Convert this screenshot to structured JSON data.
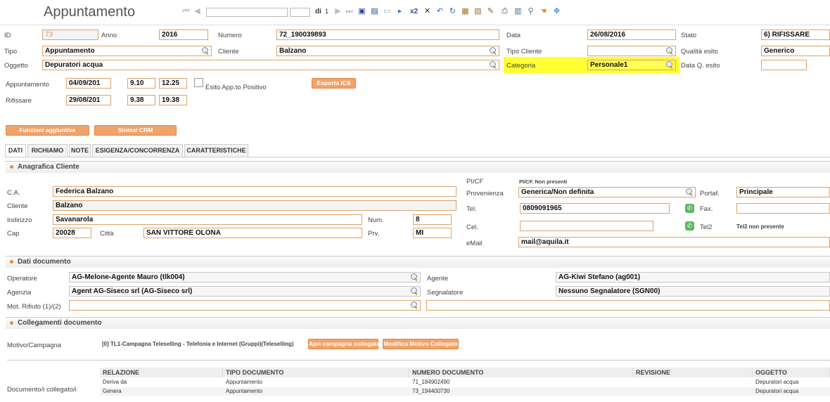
{
  "title": "Appuntamento",
  "nav": {
    "di_label": "di",
    "total": "1"
  },
  "header": {
    "id_label": "ID",
    "id_value": "73",
    "anno_label": "Anno",
    "anno_value": "2016",
    "numero_label": "Numero",
    "numero_value": "72_190039893",
    "data_label": "Data",
    "data_value": "26/08/2016",
    "stato_label": "Stato",
    "stato_value": "6) RIFISSARE",
    "tipo_label": "Tipo",
    "tipo_value": "Appuntamento",
    "cliente_label": "Cliente",
    "cliente_value": "Balzano",
    "tipo_cliente_label": "Tipo Cliente",
    "tipo_cliente_value": "",
    "qualita_label": "Qualità esito",
    "qualita_value": "Generico",
    "oggetto_label": "Oggetto",
    "oggetto_value": "Depuratori acqua",
    "categoria_label": "Categoria",
    "categoria_value": "Personale1",
    "dataq_label": "Data Q. esito",
    "dataq_value": ""
  },
  "schedule": {
    "appuntamento_label": "Appuntamento",
    "app_date": "04/09/201",
    "app_from": "9.10",
    "app_to": "12.25",
    "esito_label": "Esito App.to Positivo",
    "rifissare_label": "Rifissare",
    "rif_date": "29/08/201",
    "rif_from": "9.38",
    "rif_to": "19.38",
    "export_label": "Esporta ICS"
  },
  "buttons": {
    "funzioni": "Funzioni aggiuntive",
    "sintesi": "Sintesi CRM"
  },
  "tabs": [
    "DATI",
    "RICHIAMO",
    "NOTE",
    "ESIGENZA/CONCORRENZA",
    "CARATTERISTICHE"
  ],
  "anagrafica": {
    "title": "Anagrafica Cliente",
    "ca_label": "C.A.",
    "ca_value": "Federica Balzano",
    "cliente_label": "Cliente",
    "cliente_value": "Balzano",
    "indirizzo_label": "Indirizzo",
    "indirizzo_value": "Savanarola",
    "num_label": "Num.",
    "num_value": "8",
    "cap_label": "Cap",
    "cap_value": "20028",
    "citta_label": "Città",
    "citta_value": "SAN VITTORE OLONA",
    "prv_label": "Prv.",
    "prv_value": "MI",
    "picf_label": "PI/CF",
    "picf_value": "PI/CF. Non presenti",
    "provenienza_label": "Provenienza",
    "provenienza_value": "Generica/Non definita",
    "portaf_label": "Portaf.",
    "portaf_value": "Principale",
    "tel_label": "Tel.",
    "tel_value": "0809091965",
    "fax_label": "Fax.",
    "fax_value": "",
    "cel_label": "Cel.",
    "cel_value": "",
    "tel2_label": "Tel2",
    "tel2_value": "Tel2 non presente",
    "email_label": "eMail",
    "email_value": "mail@aquila.it"
  },
  "documento": {
    "title": "Dati documento",
    "operatore_label": "Operatore",
    "operatore_value": "AG-Melone-Agente Mauro (tlk004)",
    "agente_label": "Agente",
    "agente_value": "AG-Kiwi Stefano (ag001)",
    "agenzia_label": "Agenzia",
    "agenzia_value": "Agent AG-Siseco srl (AG-Siseco srl)",
    "segnalatore_label": "Segnalatore",
    "segnalatore_value": "Nessuno Segnalatore (SGN00)",
    "motrifiuto_label": "Mot. Rifiuto (1)/(2)",
    "motrifiuto_value": "",
    "motrifiuto2_value": ""
  },
  "collegamenti": {
    "title": "Collegamenti documento",
    "motivo_label": "Motivo/Campagna",
    "motivo_value": "[0] TL1-Campagna Teleselling - Telefonia e Internet (Gruppi)(Teleselling)",
    "apri_btn": "Apri campagna collegata",
    "modifica_btn": "Modifica Motivo Collegato",
    "doc_label": "Documento/i collegato/i",
    "columns": [
      "RELAZIONE",
      "TIPO DOCUMENTO",
      "NUMERO DOCUMENTO",
      "REVISIONE",
      "OGGETTO"
    ],
    "rows": [
      [
        "Deriva da",
        "Appuntamento",
        "71_184902490",
        "",
        "Depuratori acqua"
      ],
      [
        "Genera",
        "Appuntamento",
        "73_194400730",
        "",
        "Depuratori acqua"
      ]
    ]
  },
  "colors": {
    "accent": "#f0a36a",
    "highlight": "#ffff33"
  }
}
